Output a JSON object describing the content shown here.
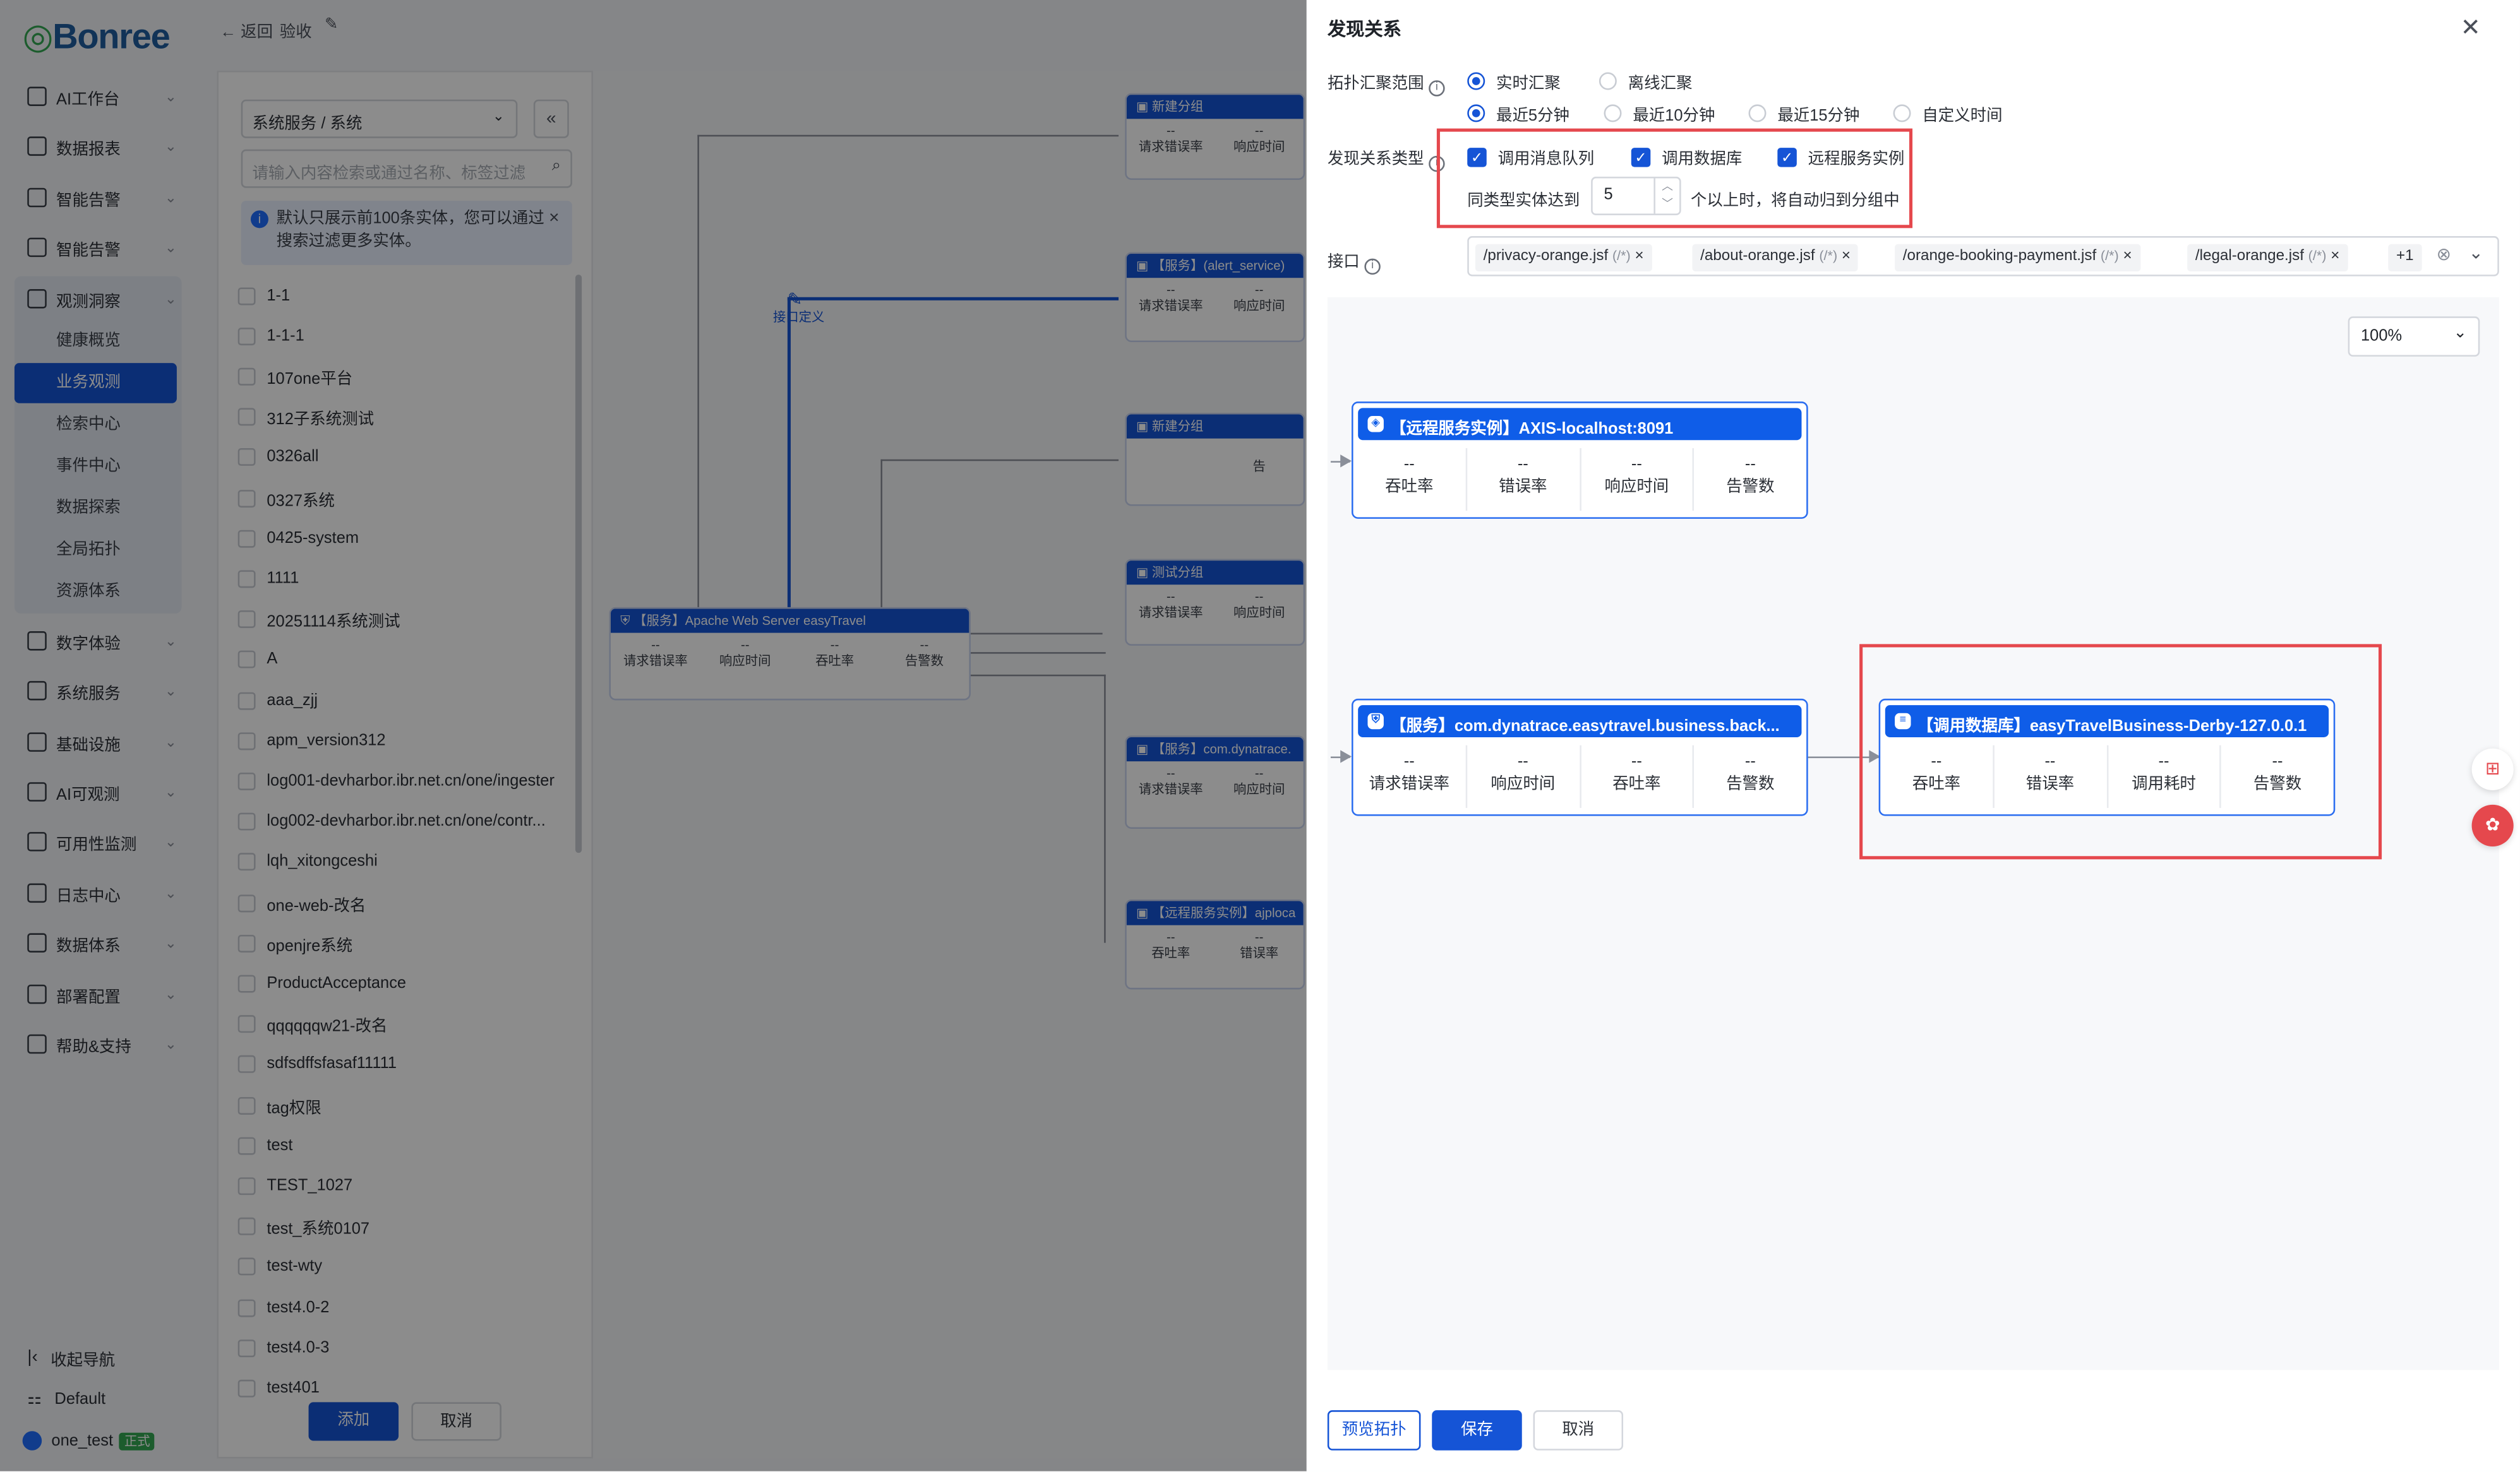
{
  "brand": {
    "logo_text": "Bonree"
  },
  "nav": {
    "items": [
      {
        "label": "AI工作台"
      },
      {
        "label": "数据报表"
      },
      {
        "label": "智能告警"
      },
      {
        "label": "智能告警"
      },
      {
        "label": "观测洞察"
      },
      {
        "label": "数字体验"
      },
      {
        "label": "系统服务"
      },
      {
        "label": "基础设施"
      },
      {
        "label": "AI可观测"
      },
      {
        "label": "可用性监测"
      },
      {
        "label": "日志中心"
      },
      {
        "label": "数据体系"
      },
      {
        "label": "部署配置"
      },
      {
        "label": "帮助&支持"
      }
    ],
    "sub_items": [
      {
        "label": "健康概览"
      },
      {
        "label": "业务观测"
      },
      {
        "label": "检索中心"
      },
      {
        "label": "事件中心"
      },
      {
        "label": "数据探索"
      },
      {
        "label": "全局拓扑"
      },
      {
        "label": "资源体系"
      }
    ],
    "collapse_label": "收起导航",
    "workspace": "Default",
    "user": "one_test",
    "user_badge": "正式"
  },
  "topbar": {
    "back": "返回",
    "title": "验收"
  },
  "left_panel": {
    "select_value": "系统服务 / 系统",
    "search_placeholder": "请输入内容检索或通过名称、标签过滤",
    "notice": "默认只展示前100条实体，您可以通过搜索过滤更多实体。",
    "items": [
      "1-1",
      "1-1-1",
      "107one平台",
      "312子系统测试",
      "0326all",
      "0327系统",
      "0425-system",
      "1111",
      "20251114系统测试",
      "A",
      "aaa_zjj",
      "apm_version312",
      "log001-devharbor.ibr.net.cn/one/ingester",
      "log002-devharbor.ibr.net.cn/one/contr...",
      "lqh_xitongceshi",
      "one-web-改名",
      "openjre系统",
      "ProductAcceptance",
      "qqqqqqw21-改名",
      "sdfsdffsfasaf11111",
      "tag权限",
      "test",
      "TEST_1027",
      "test_系统0107",
      "test-wty",
      "test4.0-2",
      "test4.0-3",
      "test401"
    ],
    "add_btn": "添加",
    "cancel_btn": "取消"
  },
  "bg_canvas": {
    "edge_label": "接口定义",
    "main_node": {
      "title": "【服务】Apache Web Server easyTravel",
      "metrics": [
        {
          "v": "--",
          "l": "请求错误率"
        },
        {
          "v": "--",
          "l": "响应时间"
        },
        {
          "v": "--",
          "l": "吞吐率"
        },
        {
          "v": "--",
          "l": "告警数"
        }
      ]
    },
    "nodes": [
      {
        "title": "新建分组",
        "metrics": [
          {
            "v": "--",
            "l": "请求错误率"
          },
          {
            "v": "--",
            "l": "响应时间"
          }
        ]
      },
      {
        "title": "【服务】(alert_service)",
        "metrics": [
          {
            "v": "--",
            "l": "请求错误率"
          },
          {
            "v": "--",
            "l": "响应时间"
          }
        ]
      },
      {
        "title": "新建分组",
        "metrics": [
          {
            "v": "",
            "l": ""
          },
          {
            "v": "",
            "l": "告"
          }
        ]
      },
      {
        "title": "测试分组",
        "metrics": [
          {
            "v": "--",
            "l": "请求错误率"
          },
          {
            "v": "--",
            "l": "响应时间"
          }
        ]
      },
      {
        "title": "【服务】com.dynatrace.",
        "metrics": [
          {
            "v": "--",
            "l": "请求错误率"
          },
          {
            "v": "--",
            "l": "响应时间"
          }
        ]
      },
      {
        "title": "【远程服务实例】ajploca",
        "metrics": [
          {
            "v": "--",
            "l": "吞吐率"
          },
          {
            "v": "--",
            "l": "错误率"
          }
        ]
      }
    ]
  },
  "drawer": {
    "title": "发现关系",
    "scope_label": "拓扑汇聚范围",
    "scope_options": [
      {
        "label": "实时汇聚",
        "selected": true
      },
      {
        "label": "离线汇聚",
        "selected": false
      }
    ],
    "time_options": [
      {
        "label": "最近5分钟",
        "selected": true
      },
      {
        "label": "最近10分钟",
        "selected": false
      },
      {
        "label": "最近15分钟",
        "selected": false
      },
      {
        "label": "自定义时间",
        "selected": false
      }
    ],
    "type_label": "发现关系类型",
    "type_options": [
      {
        "label": "调用消息队列",
        "checked": true
      },
      {
        "label": "调用数据库",
        "checked": true
      },
      {
        "label": "远程服务实例",
        "checked": true
      }
    ],
    "group_prefix": "同类型实体达到",
    "group_value": "5",
    "group_suffix": "个以上时，将自动归到分组中",
    "iface_label": "接口",
    "iface_tags": [
      {
        "name": "/privacy-orange.jsf",
        "path": "(/*)"
      },
      {
        "name": "/about-orange.jsf",
        "path": "(/*)"
      },
      {
        "name": "/orange-booking-payment.jsf",
        "path": "(/*)"
      },
      {
        "name": "/legal-orange.jsf",
        "path": "(/*)"
      }
    ],
    "iface_more": "+1",
    "zoom": "100%",
    "nodes": {
      "remote": {
        "title": "【远程服务实例】AXIS-localhost:8091",
        "metrics": [
          {
            "v": "--",
            "l": "吞吐率"
          },
          {
            "v": "--",
            "l": "错误率"
          },
          {
            "v": "--",
            "l": "响应时间"
          },
          {
            "v": "--",
            "l": "告警数"
          }
        ]
      },
      "service": {
        "title": "【服务】com.dynatrace.easytravel.business.back...",
        "metrics": [
          {
            "v": "--",
            "l": "请求错误率"
          },
          {
            "v": "--",
            "l": "响应时间"
          },
          {
            "v": "--",
            "l": "吞吐率"
          },
          {
            "v": "--",
            "l": "告警数"
          }
        ]
      },
      "db": {
        "title": "【调用数据库】easyTravelBusiness-Derby-127.0.0.1",
        "metrics": [
          {
            "v": "--",
            "l": "吞吐率"
          },
          {
            "v": "--",
            "l": "错误率"
          },
          {
            "v": "--",
            "l": "调用耗时"
          },
          {
            "v": "--",
            "l": "告警数"
          }
        ]
      }
    },
    "footer": {
      "preview": "预览拓扑",
      "save": "保存",
      "cancel": "取消"
    }
  },
  "colors": {
    "primary": "#1554d6",
    "highlight": "#e5484d",
    "node_header": "#0f5de8"
  }
}
